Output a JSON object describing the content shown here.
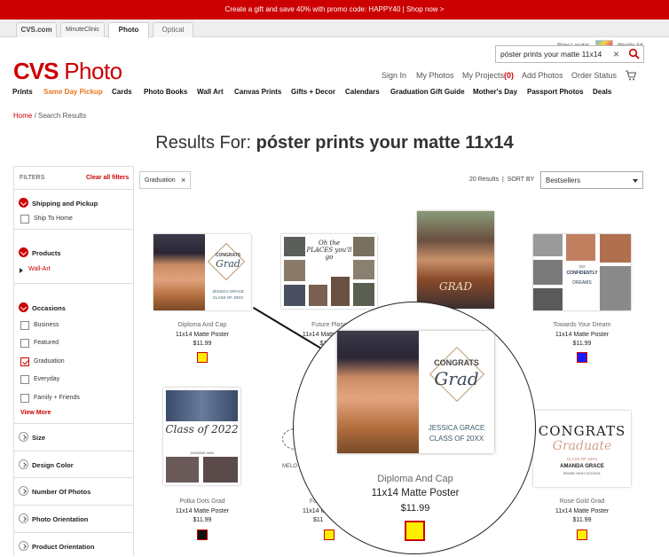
{
  "promo": {
    "text": "Create a gift and save 40% with promo code: HAPPY40 | Shop now >"
  },
  "tabs": [
    {
      "label": "CVS.com"
    },
    {
      "label": "MinuteClinic"
    },
    {
      "label": "Photo"
    },
    {
      "label": "Optical"
    }
  ],
  "top_links": {
    "store_locator": "Store Locator",
    "weekly_ad": "Weekly Ad"
  },
  "search": {
    "value": "póster prints your matte 11x14"
  },
  "logo": {
    "brand": "CVS",
    "product": " Photo"
  },
  "account_nav": {
    "sign_in": "Sign In",
    "my_photos": "My Photos",
    "my_projects": "My Projects",
    "projects_count": "(0)",
    "add_photos": "Add Photos",
    "order_status": "Order Status"
  },
  "main_nav": [
    "Prints",
    "Same Day Pickup",
    "Cards",
    "Photo Books",
    "Wall Art",
    "Canvas Prints",
    "Gifts + Decor",
    "Calendars",
    "Graduation Gift Guide",
    "Mother's Day",
    "Passport Photos",
    "Deals"
  ],
  "breadcrumb": {
    "home": "Home",
    "sep": " / ",
    "current": "Search Results"
  },
  "results": {
    "prefix": "Results For: ",
    "query": "póster prints your matte 11x14",
    "count": "20 Results",
    "divider": "|",
    "sort_label": "SORT BY",
    "sort_value": "Bestsellers"
  },
  "active_filter": {
    "label": "Graduation"
  },
  "filters": {
    "title": "FILTERS",
    "clear": "Clear all filters",
    "shipping": {
      "title": "Shipping and Pickup",
      "options": [
        "Ship To Home"
      ]
    },
    "products": {
      "title": "Products",
      "options": [
        "Wall-Art"
      ]
    },
    "occasions": {
      "title": "Occasions",
      "options": [
        "Business",
        "Featured",
        "Graduation",
        "Everyday",
        "Family + Friends"
      ],
      "view_more": "View More"
    },
    "size": "Size",
    "design_color": "Design Color",
    "number_of_photos": "Number Of Photos",
    "photo_orientation": "Photo Orientation",
    "product_orientation": "Product Orientation"
  },
  "products": [
    {
      "name": "Diploma And Cap",
      "type": "11x14 Matte Poster",
      "price": "$11.99",
      "swatch": "#ffee00"
    },
    {
      "name": "Future Plans",
      "type": "11x14 Matte Poster",
      "price": "$11.99",
      "swatch": "#ffee00"
    },
    {
      "name": "",
      "type": "",
      "price": "",
      "swatch": ""
    },
    {
      "name": "Towards Your Dream",
      "type": "11x14 Matte Poster",
      "price": "$11.99",
      "swatch": "#1a1aff"
    },
    {
      "name": "Polka Dots Grad",
      "type": "11x14 Matte Poster",
      "price": "$11.99",
      "swatch": "#111111"
    },
    {
      "name": "Fo",
      "type": "11x14 Ma",
      "price": "$11",
      "swatch": "#ffee00"
    },
    {
      "name": "",
      "type": "",
      "price": "",
      "swatch": ""
    },
    {
      "name": "Rose Gold Grad",
      "type": "11x14 Matte Poster",
      "price": "$11.99",
      "swatch": "#ffee00"
    }
  ],
  "artwork": {
    "congrats": "CONGRATS",
    "grad": "Grad",
    "name": "JESSICA GRACE",
    "class": "CLASS OF 20XX",
    "future": "Oh the PLACES you'll go",
    "class_of": "Class of 2022",
    "jasmine": "JASMINE ANN",
    "go": "GO",
    "confidently": "CONFIDENTLY",
    "dreams": "DREAMS",
    "congrats_caps": "CONGRATS",
    "graduate": "Graduate",
    "class2": "CLASS OF 20XX",
    "amanda": "AMANDA GRACE",
    "school": "IRVINE HIGH SCHOOL",
    "grad3": "GRAD",
    "melo": "MELO"
  },
  "zoom": {
    "name": "Diploma And Cap",
    "type": "11x14 Matte Poster",
    "price": "$11.99",
    "swatch": "#ffee00"
  },
  "colors": {
    "brand": "#cc0000"
  }
}
